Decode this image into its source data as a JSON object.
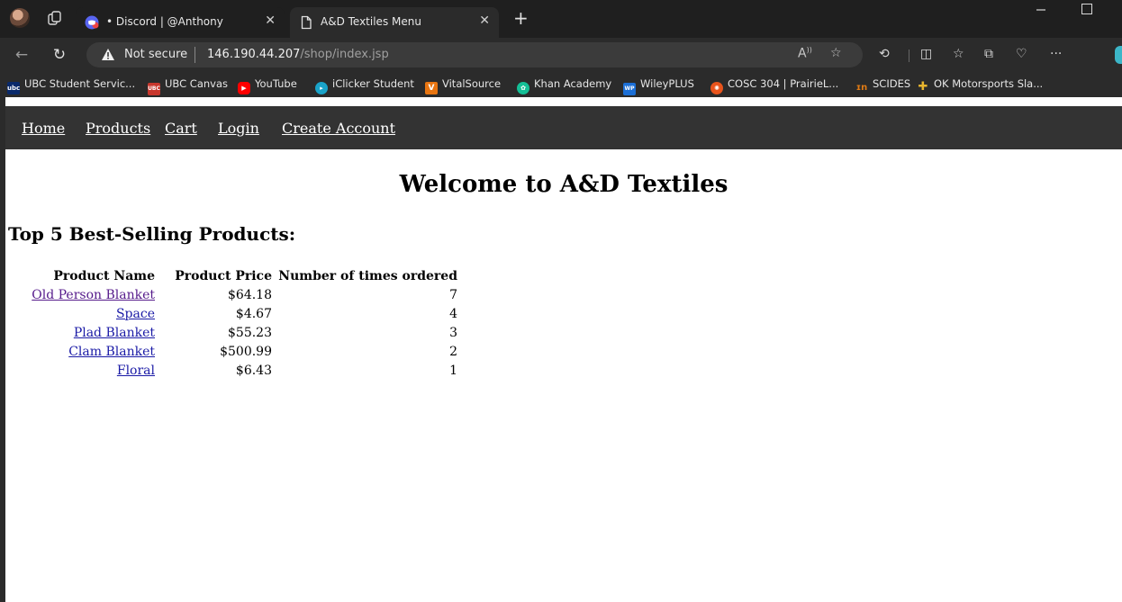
{
  "browser": {
    "tabs": [
      {
        "label": "• Discord | @Anthony",
        "close": "✕"
      },
      {
        "label": "A&D Textiles Menu",
        "close": "✕"
      }
    ],
    "new_tab": "+",
    "address": {
      "security_label": "Not secure",
      "host": "146.190.44.207",
      "path": "/shop/index.jsp"
    },
    "bookmarks": [
      {
        "label": "UBC Student Servic...",
        "icon": "ubc",
        "color": "#0a2a6b"
      },
      {
        "label": "UBC Canvas",
        "icon": "ubc-canvas",
        "color": "#c8372d"
      },
      {
        "label": "YouTube",
        "icon": "youtube",
        "color": "#ff0000"
      },
      {
        "label": "iClicker Student",
        "icon": "iclicker",
        "color": "#1aa3c9"
      },
      {
        "label": "VitalSource",
        "icon": "vitalsource",
        "color": "#e87511"
      },
      {
        "label": "Khan Academy",
        "icon": "khan",
        "color": "#14bf96"
      },
      {
        "label": "WileyPLUS",
        "icon": "wiley",
        "color": "#1c6fd6"
      },
      {
        "label": "COSC 304 | PrairieL...",
        "icon": "prairielearn",
        "color": "#e8541c"
      },
      {
        "label": "SCIDES",
        "icon": "scides",
        "color": "#e07b14"
      },
      {
        "label": "OK Motorsports Sla...",
        "icon": "slack",
        "color": "#4a154b"
      }
    ]
  },
  "site": {
    "nav": [
      "Home",
      "Products",
      "Cart",
      "Login",
      "Create Account"
    ],
    "title": "Welcome to A&D Textiles",
    "subtitle": "Top 5 Best-Selling Products:",
    "table": {
      "headers": [
        "Product Name",
        "Product Price",
        "Number of times ordered"
      ],
      "rows": [
        {
          "name": "Old Person Blanket",
          "price": "$64.18",
          "count": "7",
          "visited": true
        },
        {
          "name": "Space",
          "price": "$4.67",
          "count": "4",
          "visited": false
        },
        {
          "name": "Plad Blanket",
          "price": "$55.23",
          "count": "3",
          "visited": false
        },
        {
          "name": "Clam Blanket",
          "price": "$500.99",
          "count": "2",
          "visited": false
        },
        {
          "name": "Floral",
          "price": "$6.43",
          "count": "1",
          "visited": false
        }
      ]
    }
  }
}
